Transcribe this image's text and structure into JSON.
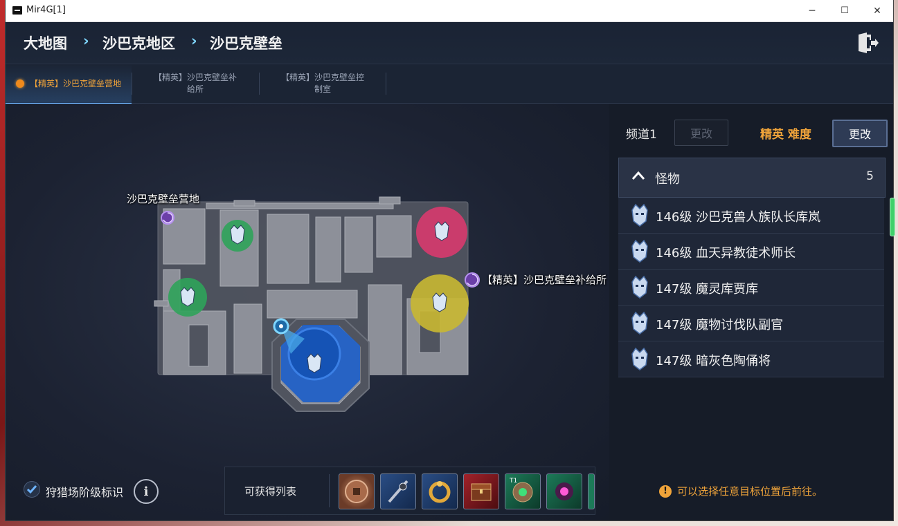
{
  "window": {
    "title": "Mir4G[1]",
    "minimize": "─",
    "maximize": "☐",
    "close": "✕"
  },
  "breadcrumb": [
    "大地图",
    "沙巴克地区",
    "沙巴克壁垒"
  ],
  "tabs": [
    {
      "label": "【精英】沙巴克壁垒营地",
      "active": true
    },
    {
      "label_line1": "【精英】沙巴克壁垒补",
      "label_line2": "给所",
      "active": false
    },
    {
      "label_line1": "【精英】沙巴克壁垒控",
      "label_line2": "制室",
      "active": false
    }
  ],
  "map": {
    "labels": {
      "camp": "沙巴克壁垒营地",
      "supply": "【精英】沙巴克壁垒补给所"
    }
  },
  "panel": {
    "channel_label": "频道1",
    "channel_change": "更改",
    "difficulty_label": "精英 难度",
    "difficulty_change": "更改",
    "monster_header": "怪物",
    "monster_count": "5",
    "monsters": [
      "146级 沙巴克兽人族队长库岚",
      "146级 血天异教徒术师长",
      "147级 魔灵库贾库",
      "147级 魔物讨伐队副官",
      "147级 暗灰色陶俑将"
    ],
    "hint": "可以选择任意目标位置后前往。"
  },
  "bottom": {
    "hunt_label": "狩猎场阶级标识",
    "info_icon": "i",
    "loot_label": "可获得列表",
    "loot_items": [
      "coin-icon",
      "staff-icon",
      "dragon-ring-icon",
      "chest-icon",
      "emerald-relic-icon",
      "pink-gem-icon"
    ]
  },
  "colors": {
    "accent_orange": "#f0a43a",
    "zone_green": "#2fa35a",
    "zone_pink": "#d83a6e",
    "zone_yellow": "#c9b832",
    "zone_blue": "#1e5fc8"
  }
}
